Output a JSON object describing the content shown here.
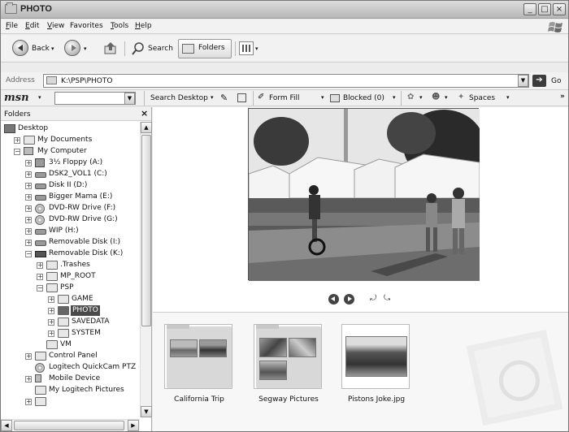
{
  "window": {
    "title": "PHOTO"
  },
  "menu": {
    "file": "F",
    "file_rest": "ile",
    "edit": "E",
    "edit_rest": "dit",
    "view": "V",
    "view_rest": "iew",
    "favorites": "Favorites",
    "tools": "T",
    "tools_rest": "ools",
    "help": "H",
    "help_rest": "elp"
  },
  "toolbar": {
    "back": "Back",
    "search": "Search",
    "folders": "Folders"
  },
  "address": {
    "label": "Address",
    "value": "K:\\PSP\\PHOTO",
    "go": "Go"
  },
  "msn": {
    "logo": "msn",
    "search_desktop": "Search Desktop",
    "form_fill": "Form Fill",
    "blocked": "Blocked (0)",
    "spaces": "Spaces"
  },
  "folders_pane": {
    "title": "Folders",
    "tree": [
      {
        "label": "Desktop"
      },
      {
        "label": "My Documents"
      },
      {
        "label": "My Computer"
      },
      {
        "label": "3½ Floppy (A:)"
      },
      {
        "label": "DSK2_VOL1 (C:)"
      },
      {
        "label": "Disk II (D:)"
      },
      {
        "label": "Bigger Mama (E:)"
      },
      {
        "label": "DVD-RW Drive (F:)"
      },
      {
        "label": "DVD-RW Drive (G:)"
      },
      {
        "label": "WIP (H:)"
      },
      {
        "label": "Removable Disk (I:)"
      },
      {
        "label": "Removable Disk (K:)"
      },
      {
        "label": ".Trashes"
      },
      {
        "label": "MP_ROOT"
      },
      {
        "label": "PSP"
      },
      {
        "label": "GAME"
      },
      {
        "label": "PHOTO"
      },
      {
        "label": "SAVEDATA"
      },
      {
        "label": "SYSTEM"
      },
      {
        "label": "VM"
      },
      {
        "label": "Control Panel"
      },
      {
        "label": "Logitech QuickCam PTZ #"
      },
      {
        "label": "Mobile Device"
      },
      {
        "label": "My Logitech Pictures"
      }
    ]
  },
  "filmstrip": {
    "items": [
      {
        "caption": "California Trip"
      },
      {
        "caption": "Segway Pictures"
      },
      {
        "caption": "Pistons Joke.jpg"
      }
    ]
  },
  "colors": {
    "selection": "#4a4a4a",
    "window_bg": "#ececec"
  }
}
